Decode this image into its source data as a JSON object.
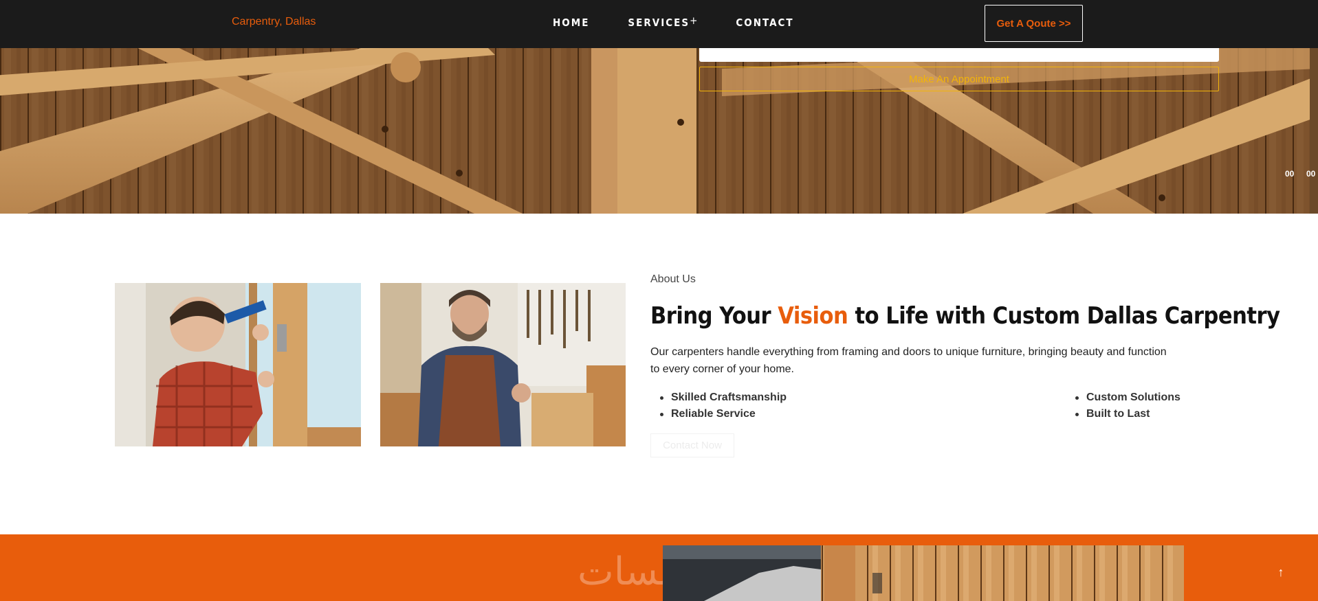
{
  "header": {
    "brand": "Carpentry, Dallas",
    "nav": [
      {
        "label": "HOME"
      },
      {
        "label": "SERVICES",
        "suffix": "+"
      },
      {
        "label": "CONTACT"
      }
    ],
    "cta": "Get A Qoute >>"
  },
  "hero": {
    "appointment_button": "Make An Appointment",
    "counters": [
      "00",
      "00"
    ]
  },
  "about": {
    "label": "About Us",
    "title_before": "Bring Your ",
    "title_accent": "Vision",
    "title_after": " to Life with Custom Dallas Carpentry",
    "description": "Our carpenters handle everything from framing and doors to unique furniture, bringing beauty and function to every corner of your home.",
    "features_left": [
      "Skilled Craftsmanship",
      "Reliable Service"
    ],
    "features_right": [
      "Custom Solutions",
      "Built to Last"
    ],
    "contact_button": "Contact Now"
  },
  "band": {
    "watermark": "خمسات"
  },
  "scroll_top": "↑",
  "colors": {
    "accent": "#e85d0c",
    "header_bg": "#1b1b1b",
    "appointment": "#f2b40a"
  }
}
